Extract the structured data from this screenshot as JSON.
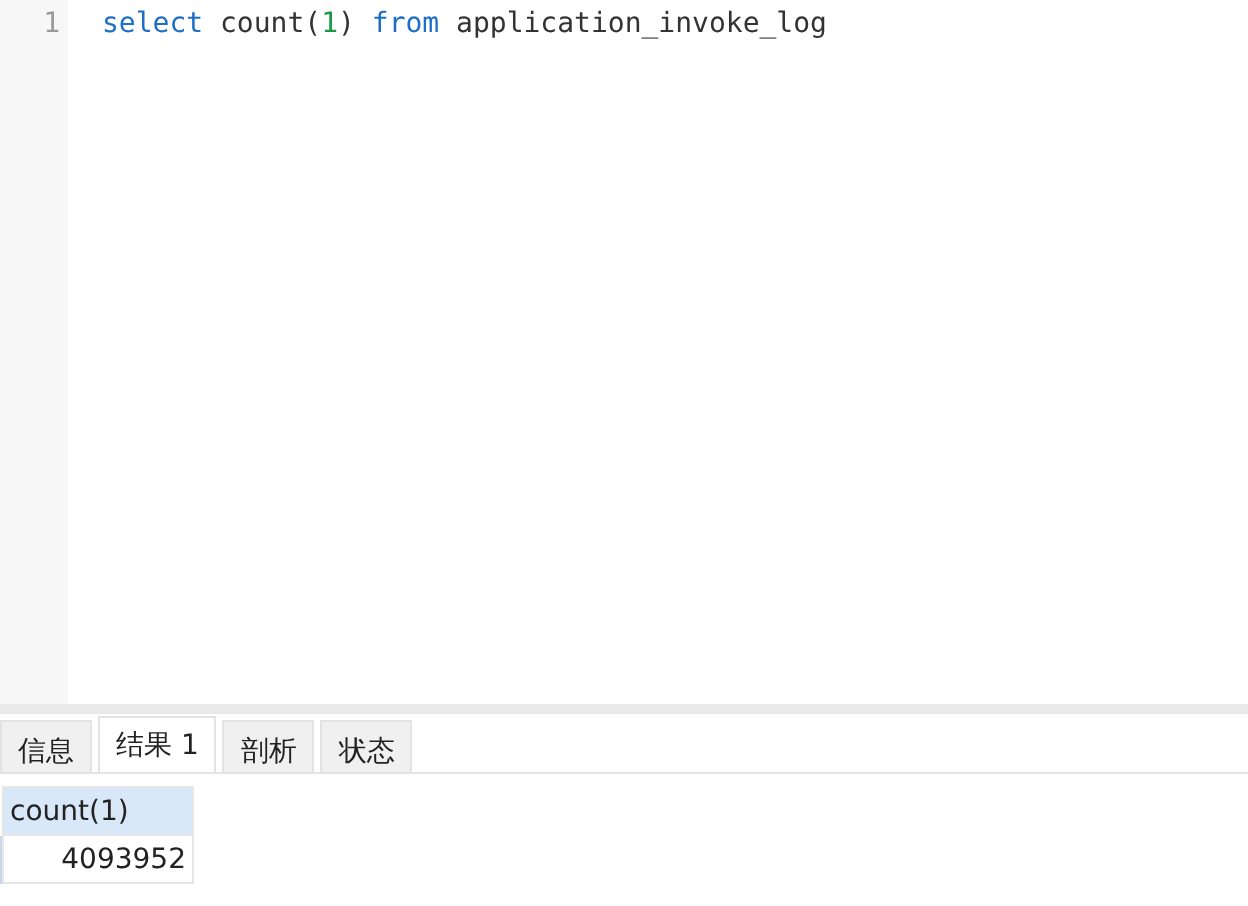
{
  "editor": {
    "lines": [
      {
        "number": "1",
        "tokens": [
          {
            "kind": "keyword",
            "text": "select"
          },
          {
            "kind": "plain",
            "text": " count("
          },
          {
            "kind": "number",
            "text": "1"
          },
          {
            "kind": "plain",
            "text": ") "
          },
          {
            "kind": "keyword",
            "text": "from"
          },
          {
            "kind": "plain",
            "text": " application_invoke_log"
          }
        ]
      }
    ]
  },
  "result_tabs": [
    {
      "label": "信息",
      "selected": false
    },
    {
      "label": "结果 1",
      "selected": true
    },
    {
      "label": "剖析",
      "selected": false
    },
    {
      "label": "状态",
      "selected": false
    }
  ],
  "result_grid": {
    "columns": [
      "count(1)"
    ],
    "rows": [
      [
        "4093952"
      ]
    ]
  }
}
